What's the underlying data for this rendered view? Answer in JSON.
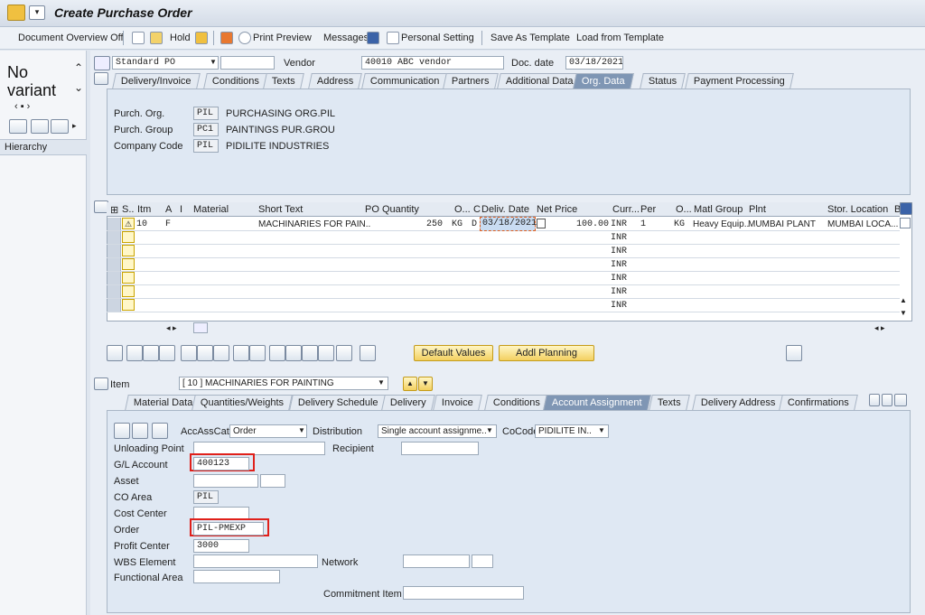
{
  "title": "Create Purchase Order",
  "toolbar": {
    "doc_overview": "Document Overview Off",
    "hold": "Hold",
    "print_preview": "Print Preview",
    "messages": "Messages",
    "personal_setting": "Personal Setting",
    "save_template": "Save As Template",
    "load_template": "Load from Template"
  },
  "left": {
    "no_variant": "No variant",
    "hierarchy": "Hierarchy"
  },
  "header": {
    "doc_type": "Standard PO",
    "vendor_label": "Vendor",
    "vendor_value": "40010 ABC vendor",
    "docdate_label": "Doc. date",
    "docdate_value": "03/18/2021"
  },
  "header_tabs": [
    "Delivery/Invoice",
    "Conditions",
    "Texts",
    "Address",
    "Communication",
    "Partners",
    "Additional Data",
    "Org. Data",
    "Status",
    "Payment Processing"
  ],
  "org": {
    "porg_label": "Purch. Org.",
    "porg_code": "PIL",
    "porg_text": "PURCHASING ORG.PIL",
    "pgroup_label": "Purch. Group",
    "pgroup_code": "PC1",
    "pgroup_text": "PAINTINGS PUR.GROU",
    "company_label": "Company Code",
    "company_code": "PIL",
    "company_text": "PIDILITE INDUSTRIES"
  },
  "grid": {
    "headers": [
      "S..",
      "Itm",
      "A",
      "I",
      "Material",
      "Short Text",
      "PO Quantity",
      "O...",
      "C",
      "Deliv. Date",
      "Net Price",
      "Curr...",
      "Per",
      "O...",
      "Matl Group",
      "Plnt",
      "Stor. Location",
      "B"
    ],
    "row1": {
      "itm": "10",
      "a": "F",
      "short_text": "MACHINARIES FOR PAIN..",
      "qty": "250",
      "uom": "KG",
      "c": "D",
      "date": "03/18/2021",
      "price": "100.00",
      "curr": "INR",
      "per": "1",
      "ouom": "KG",
      "matl_group": "Heavy Equip..",
      "plant": "MUMBAI PLANT",
      "sloc": "MUMBAI LOCA..."
    },
    "curr_rows": [
      "INR",
      "INR",
      "INR",
      "INR",
      "INR",
      "INR"
    ]
  },
  "buttons": {
    "default_values": "Default Values",
    "addl_planning": "Addl Planning"
  },
  "item": {
    "label": "Item",
    "selected": "[ 10 ] MACHINARIES FOR PAINTING"
  },
  "item_tabs": [
    "Material Data",
    "Quantities/Weights",
    "Delivery Schedule",
    "Delivery",
    "Invoice",
    "Conditions",
    "Account Assignment",
    "Texts",
    "Delivery Address",
    "Confirmations"
  ],
  "acct": {
    "accasscat_label": "AccAssCat",
    "accasscat_value": "Order",
    "distribution_label": "Distribution",
    "distribution_value": "Single account assignme..",
    "cocode_label": "CoCode",
    "cocode_value": "PIDILITE IN..",
    "unloading_label": "Unloading Point",
    "recipient_label": "Recipient",
    "gl_label": "G/L Account",
    "gl_value": "400123",
    "asset_label": "Asset",
    "coarea_label": "CO Area",
    "coarea_value": "PIL",
    "costcenter_label": "Cost Center",
    "order_label": "Order",
    "order_value": "PIL-PMEXP",
    "profit_label": "Profit Center",
    "profit_value": "3000",
    "wbs_label": "WBS Element",
    "network_label": "Network",
    "functional_label": "Functional Area",
    "commitment_label": "Commitment Item"
  },
  "colors": {
    "active_tab": "#7f96b4",
    "highlight": "#e0201a"
  }
}
